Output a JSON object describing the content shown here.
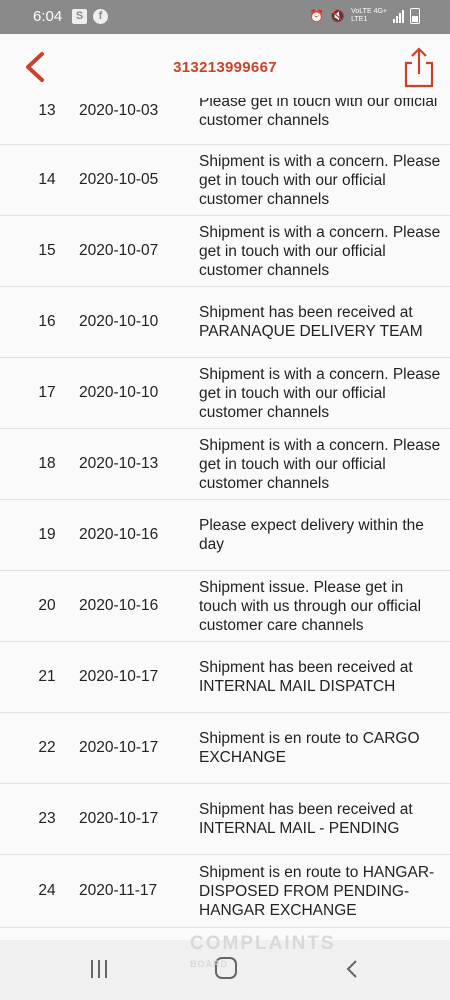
{
  "status_bar": {
    "time": "6:04",
    "notif_icons": [
      "S",
      "f"
    ],
    "net_label_top": "VoLTE 4G+",
    "net_label_bottom": "LTE1"
  },
  "header": {
    "title": "313213999667"
  },
  "accent_color": "#c7432a",
  "rows": [
    {
      "num": "13",
      "date": "2020-10-03",
      "desc": "Please get in touch with our official customer channels"
    },
    {
      "num": "14",
      "date": "2020-10-05",
      "desc": "Shipment is with a concern. Please get in touch with our official customer channels"
    },
    {
      "num": "15",
      "date": "2020-10-07",
      "desc": "Shipment is with a concern. Please get in touch with our official customer channels"
    },
    {
      "num": "16",
      "date": "2020-10-10",
      "desc": "Shipment has been received at PARANAQUE DELIVERY TEAM"
    },
    {
      "num": "17",
      "date": "2020-10-10",
      "desc": "Shipment is with a concern. Please get in touch with our official customer channels"
    },
    {
      "num": "18",
      "date": "2020-10-13",
      "desc": "Shipment is with a concern. Please get in touch with our official customer channels"
    },
    {
      "num": "19",
      "date": "2020-10-16",
      "desc": "Please expect delivery within the day"
    },
    {
      "num": "20",
      "date": "2020-10-16",
      "desc": "Shipment issue. Please get in touch with us through our official customer care channels"
    },
    {
      "num": "21",
      "date": "2020-10-17",
      "desc": "Shipment has been received at INTERNAL MAIL DISPATCH"
    },
    {
      "num": "22",
      "date": "2020-10-17",
      "desc": "Shipment is en route to CARGO EXCHANGE"
    },
    {
      "num": "23",
      "date": "2020-10-17",
      "desc": "Shipment has been received at INTERNAL MAIL - PENDING"
    },
    {
      "num": "24",
      "date": "2020-11-17",
      "desc": "Shipment is en route to HANGAR-DISPOSED FROM PENDING-HANGAR EXCHANGE"
    }
  ],
  "watermark": {
    "line1": "COMPLAINTS",
    "line2": "BOARD"
  }
}
